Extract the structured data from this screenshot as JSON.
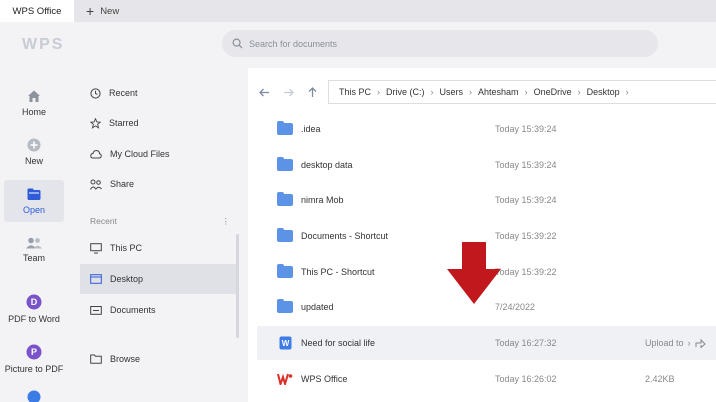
{
  "tabs": {
    "active": "WPS Office",
    "new_label": "New"
  },
  "header": {
    "logo": "WPS",
    "search_placeholder": "Search for documents"
  },
  "nav": [
    {
      "label": "Home",
      "icon": "home-icon"
    },
    {
      "label": "New",
      "icon": "plus-circle-icon"
    },
    {
      "label": "Open",
      "icon": "folder-icon"
    },
    {
      "label": "Team",
      "icon": "team-icon"
    },
    {
      "label": "PDF to Word",
      "icon": "pdf-to-word-icon"
    },
    {
      "label": "Picture to PDF",
      "icon": "picture-to-pdf-icon"
    }
  ],
  "folders": {
    "items": [
      {
        "label": "Recent",
        "icon": "clock-icon"
      },
      {
        "label": "Starred",
        "icon": "star-icon"
      },
      {
        "label": "My Cloud Files",
        "icon": "cloud-icon"
      },
      {
        "label": "Share",
        "icon": "share-icon"
      }
    ],
    "recent_header": "Recent",
    "recent": [
      {
        "label": "This PC",
        "icon": "monitor-icon"
      },
      {
        "label": "Desktop",
        "icon": "desktop-icon"
      },
      {
        "label": "Documents",
        "icon": "documents-icon"
      }
    ],
    "browse": "Browse"
  },
  "breadcrumb": [
    "This PC",
    "Drive (C:)",
    "Users",
    "Ahtesham",
    "OneDrive",
    "Desktop"
  ],
  "files": [
    {
      "name": ".idea",
      "time": "Today 15:39:24",
      "type": "folder"
    },
    {
      "name": "desktop data",
      "time": "Today 15:39:24",
      "type": "folder"
    },
    {
      "name": "nimra Mob",
      "time": "Today 15:39:24",
      "type": "folder"
    },
    {
      "name": "Documents - Shortcut",
      "time": "Today 15:39:22",
      "type": "folder"
    },
    {
      "name": "This PC - Shortcut",
      "time": "Today 15:39:22",
      "type": "folder"
    },
    {
      "name": "updated",
      "time": "7/24/2022",
      "type": "folder"
    },
    {
      "name": "Need for social life",
      "time": "Today 16:27:32",
      "type": "doc",
      "extra": "Upload to"
    },
    {
      "name": "WPS Office",
      "time": "Today 16:26:02",
      "type": "wps",
      "extra": "2.42KB"
    }
  ],
  "colors": {
    "accent": "#2f5bd8",
    "folder": "#5d93e6",
    "red_arrow": "#c0181c",
    "nav_pdf": "#7a52c9"
  }
}
